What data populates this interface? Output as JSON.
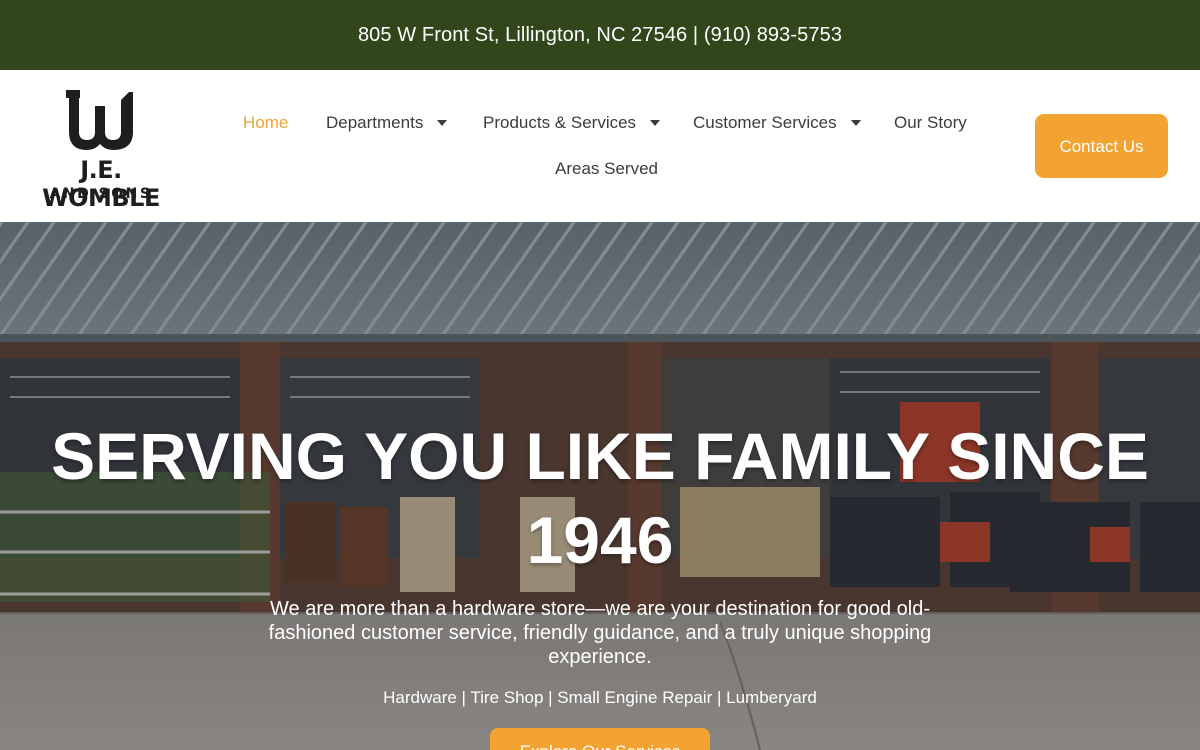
{
  "topbar": {
    "contact_line": "805 W Front St, Lillington, NC 27546 | (910) 893-5753"
  },
  "logo": {
    "name": "J.E. WOMBLE",
    "tagline": "AND SONS"
  },
  "nav": {
    "items": [
      {
        "label": "Home",
        "active": true,
        "dropdown": false
      },
      {
        "label": "Departments",
        "active": false,
        "dropdown": true
      },
      {
        "label": "Products & Services",
        "active": false,
        "dropdown": true
      },
      {
        "label": "Customer Services",
        "active": false,
        "dropdown": true
      },
      {
        "label": "Our Story",
        "active": false,
        "dropdown": false
      },
      {
        "label": "Areas Served",
        "active": false,
        "dropdown": false
      }
    ],
    "contact_button": "Contact Us"
  },
  "hero": {
    "title": "SERVING YOU LIKE FAMILY SINCE 1946",
    "subtitle": "We are more than a hardware store—we are your destination for good old-fashioned customer service, friendly guidance, and a truly unique shopping experience.",
    "services": "Hardware | Tire Shop | Small Engine Repair | Lumberyard",
    "cta": "Explore Our Services"
  },
  "colors": {
    "topbar_bg": "#31461b",
    "accent": "#f2a332",
    "nav_text": "#3c3c3c"
  }
}
